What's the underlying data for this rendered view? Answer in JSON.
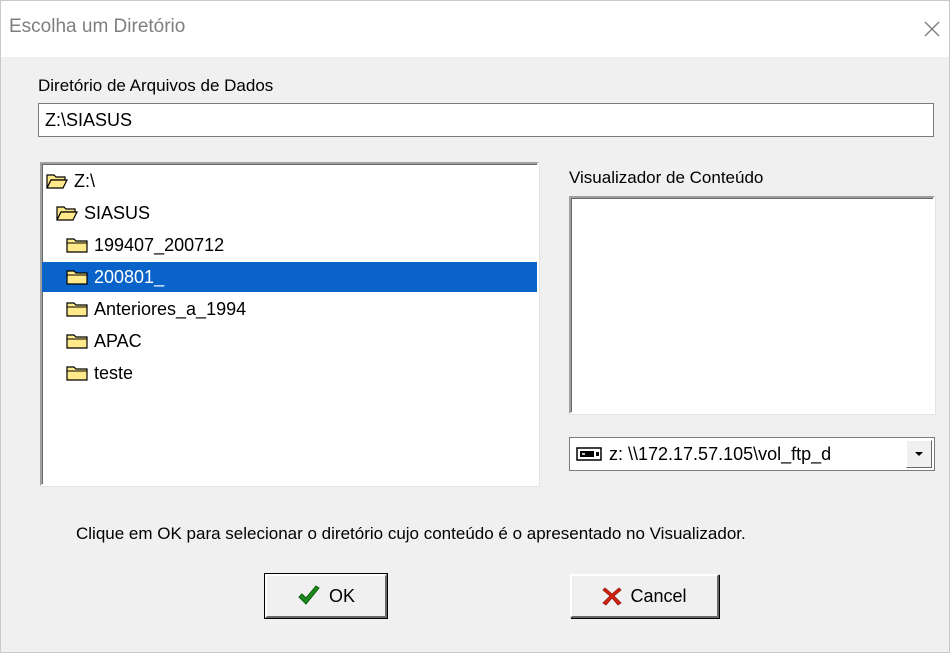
{
  "window": {
    "title": "Escolha um Diretório",
    "close_icon": "close-icon"
  },
  "data_dir": {
    "label": "Diretório de Arquivos de Dados",
    "value": "Z:\\SIASUS"
  },
  "tree": {
    "items": [
      {
        "label": "Z:\\",
        "icon": "open-folder-icon",
        "level": 0,
        "selected": false
      },
      {
        "label": "SIASUS",
        "icon": "open-folder-icon",
        "level": 1,
        "selected": false
      },
      {
        "label": "199407_200712",
        "icon": "folder-icon",
        "level": 2,
        "selected": false
      },
      {
        "label": "200801_",
        "icon": "folder-icon",
        "level": 2,
        "selected": true
      },
      {
        "label": "Anteriores_a_1994",
        "icon": "folder-icon",
        "level": 2,
        "selected": false
      },
      {
        "label": "APAC",
        "icon": "folder-icon",
        "level": 2,
        "selected": false
      },
      {
        "label": "teste",
        "icon": "folder-icon",
        "level": 2,
        "selected": false
      }
    ]
  },
  "viewer": {
    "label": "Visualizador de Conteúdo"
  },
  "drive_select": {
    "icon": "network-drive-icon",
    "value": "z: \\\\172.17.57.105\\vol_ftp_d"
  },
  "hint": "Clique em OK para selecionar o diretório cujo conteúdo é o apresentado no Visualizador.",
  "buttons": {
    "ok": {
      "label": "OK",
      "icon": "checkmark-icon"
    },
    "cancel": {
      "label": "Cancel",
      "icon": "x-cross-icon"
    }
  },
  "colors": {
    "selection": "#0a63c9",
    "folder": "#ffe98a",
    "ok_check": "#1c8a1c",
    "cancel_x": "#d6220f"
  }
}
